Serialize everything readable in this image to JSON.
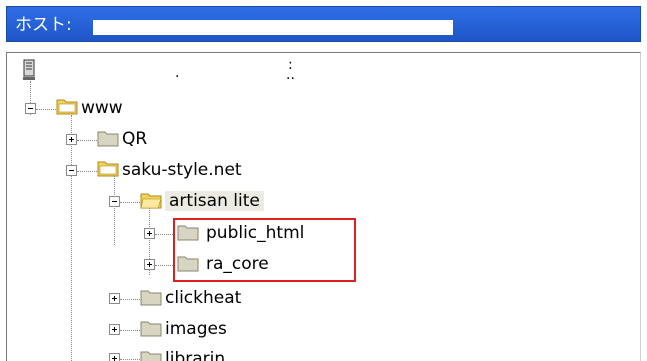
{
  "host": {
    "label": "ホスト:"
  },
  "root": {
    "dot1": ".",
    "dot2": ":",
    "dot3": ".."
  },
  "tree": [
    {
      "label": "www"
    },
    {
      "label": "QR"
    },
    {
      "label": "saku-style.net"
    },
    {
      "label": "artisan lite"
    },
    {
      "label": "public_html"
    },
    {
      "label": "ra_core"
    },
    {
      "label": "clickheat"
    },
    {
      "label": "images"
    },
    {
      "label": "librarin"
    }
  ],
  "colors": {
    "titlebar": "#1f56c8",
    "highlight": "#e01f1f",
    "folder": "#f2d35b"
  }
}
